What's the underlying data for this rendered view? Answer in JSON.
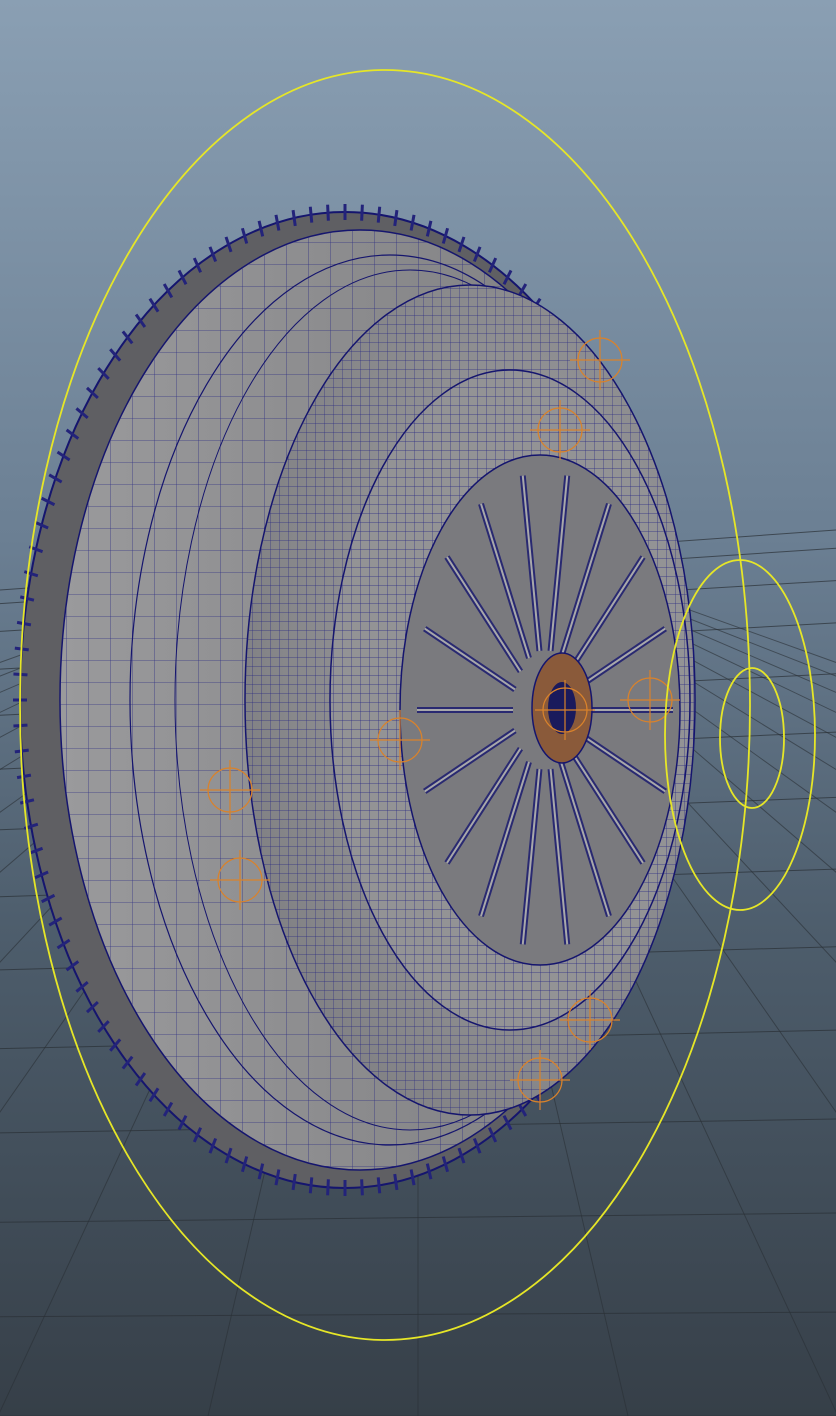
{
  "viewport": {
    "background_top": "#8a9fb3",
    "background_bottom": "#363f48",
    "grid_color": "#2a3036",
    "shaded_surface_color": "#8f8f91",
    "wireframe_color": "#17177a",
    "selection_handle_color": "#e6e627",
    "joint_color": "#d9822b"
  },
  "model": {
    "icon": "clutch-assembly-icon",
    "ring_gear_teeth": 120,
    "diaphragm_fingers": 18
  }
}
